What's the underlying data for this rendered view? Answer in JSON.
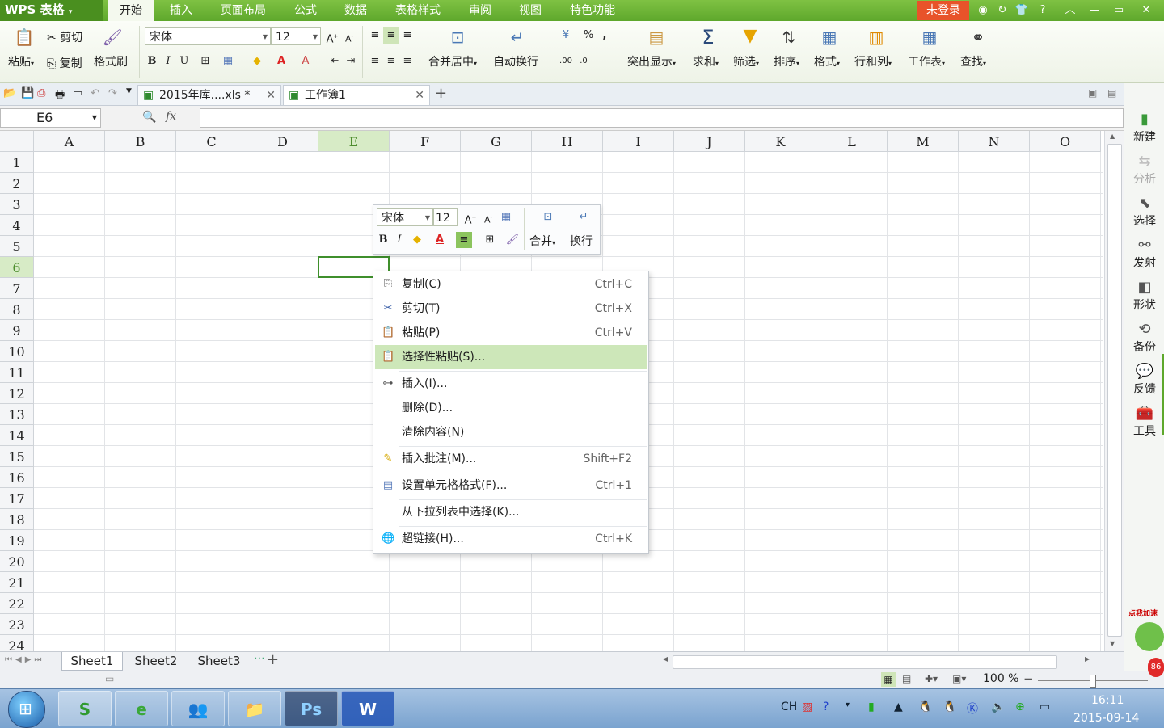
{
  "app": {
    "logo": "WPS 表格",
    "menu": [
      "开始",
      "插入",
      "页面布局",
      "公式",
      "数据",
      "表格样式",
      "审阅",
      "视图",
      "特色功能"
    ],
    "login": "未登录",
    "window_controls": [
      "?",
      "—",
      "▭",
      "✕"
    ]
  },
  "ribbon": {
    "paste": "粘贴",
    "cut": "剪切",
    "copy": "复制",
    "format_painter": "格式刷",
    "font_name": "宋体",
    "font_size": "12",
    "bold": "B",
    "italic": "I",
    "underline": "U",
    "merge_center": "合并居中",
    "wrap": "自动换行",
    "percent": "%",
    "comma": ",",
    "highlight": "突出显示",
    "sum": "求和",
    "filter": "筛选",
    "sort": "排序",
    "format": "格式",
    "rowcol": "行和列",
    "worksheet": "工作表",
    "find": "查找"
  },
  "doc_tabs": [
    "2015年库....xls *",
    "工作簿1"
  ],
  "formula_bar": {
    "name_box": "E6",
    "fx": "fx",
    "value": ""
  },
  "columns": [
    "A",
    "B",
    "C",
    "D",
    "E",
    "F",
    "G",
    "H",
    "I",
    "J",
    "K",
    "L",
    "M",
    "N",
    "O"
  ],
  "rows": [
    "1",
    "2",
    "3",
    "4",
    "5",
    "6",
    "7",
    "8",
    "9",
    "10",
    "11",
    "12",
    "13",
    "14",
    "15",
    "16",
    "17",
    "18",
    "19",
    "20",
    "21",
    "22",
    "23",
    "24"
  ],
  "selected": {
    "col": "E",
    "row": "6"
  },
  "mini_toolbar": {
    "font": "宋体",
    "size": "12",
    "merge": "合并",
    "wrap": "换行",
    "bold": "B",
    "italic": "I"
  },
  "context_menu": [
    {
      "label": "复制(C)",
      "shortcut": "Ctrl+C",
      "icon": "copy-icon"
    },
    {
      "label": "剪切(T)",
      "shortcut": "Ctrl+X",
      "icon": "cut-icon"
    },
    {
      "label": "粘贴(P)",
      "shortcut": "Ctrl+V",
      "icon": "paste-icon"
    },
    {
      "label": "选择性粘贴(S)...",
      "shortcut": "",
      "icon": "paste-special-icon",
      "highlight": true
    },
    {
      "label": "插入(I)...",
      "shortcut": "",
      "icon": "insert-icon"
    },
    {
      "label": "删除(D)...",
      "shortcut": "",
      "icon": ""
    },
    {
      "label": "清除内容(N)",
      "shortcut": "",
      "icon": ""
    },
    {
      "label": "插入批注(M)...",
      "shortcut": "Shift+F2",
      "icon": "comment-icon"
    },
    {
      "label": "设置单元格格式(F)...",
      "shortcut": "Ctrl+1",
      "icon": "format-cells-icon"
    },
    {
      "label": "从下拉列表中选择(K)...",
      "shortcut": "",
      "icon": ""
    },
    {
      "label": "超链接(H)...",
      "shortcut": "Ctrl+K",
      "icon": "hyperlink-icon"
    }
  ],
  "sidebar": [
    "新建",
    "分析",
    "选择",
    "发射",
    "形状",
    "备份",
    "反馈",
    "工具"
  ],
  "sheets": [
    "Sheet1",
    "Sheet2",
    "Sheet3"
  ],
  "status": {
    "zoom": "100 %"
  },
  "taskbar": {
    "lang": "CH",
    "time": "16:11",
    "date": "2015-09-14",
    "apps": [
      "S",
      "e",
      "👥",
      "📁",
      "Ps",
      "W"
    ]
  },
  "colors": {
    "accent": "#5ea82c",
    "login": "#e8532a",
    "selection": "#3f8f2c",
    "menu_highlight": "#cde7b9"
  }
}
